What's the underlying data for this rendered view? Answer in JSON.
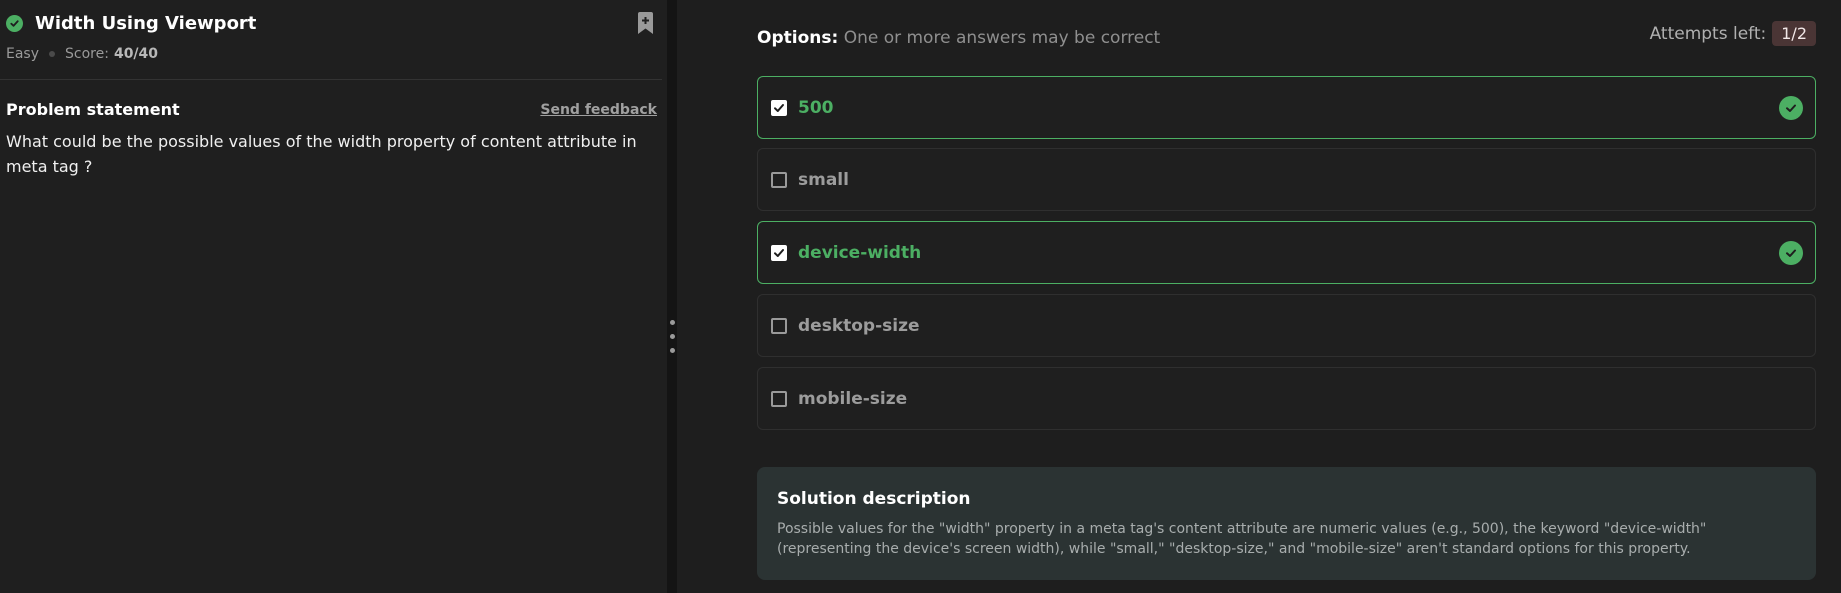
{
  "problem": {
    "title": "Width Using Viewport",
    "difficulty": "Easy",
    "score_label": "Score:",
    "score_value": "40/40",
    "statement_heading": "Problem statement",
    "feedback_link": "Send feedback",
    "question": "What could be the possible values of the width property of content attribute in meta tag ?"
  },
  "options_panel": {
    "heading": "Options:",
    "hint": "One or more answers may be correct",
    "attempts_label": "Attempts left:",
    "attempts_value": "1/2",
    "options": [
      {
        "label": "500",
        "checked": true,
        "correct": true
      },
      {
        "label": "small",
        "checked": false,
        "correct": false
      },
      {
        "label": "device-width",
        "checked": true,
        "correct": true
      },
      {
        "label": "desktop-size",
        "checked": false,
        "correct": false
      },
      {
        "label": "mobile-size",
        "checked": false,
        "correct": false
      }
    ]
  },
  "solution": {
    "title": "Solution description",
    "text": "Possible values for the \"width\" property in a meta tag's content attribute are numeric values (e.g., 500), the keyword \"device-width\" (representing the device's screen width), while \"small,\" \"desktop-size,\" and \"mobile-size\" aren't standard options for this property."
  },
  "colors": {
    "correct": "#4caf63",
    "background": "#1e1e1e",
    "solution_bg": "#2b3333"
  },
  "icons": {
    "status": "check-circle-icon",
    "bookmark": "bookmark-add-icon",
    "splitter": "drag-handle-icon"
  }
}
